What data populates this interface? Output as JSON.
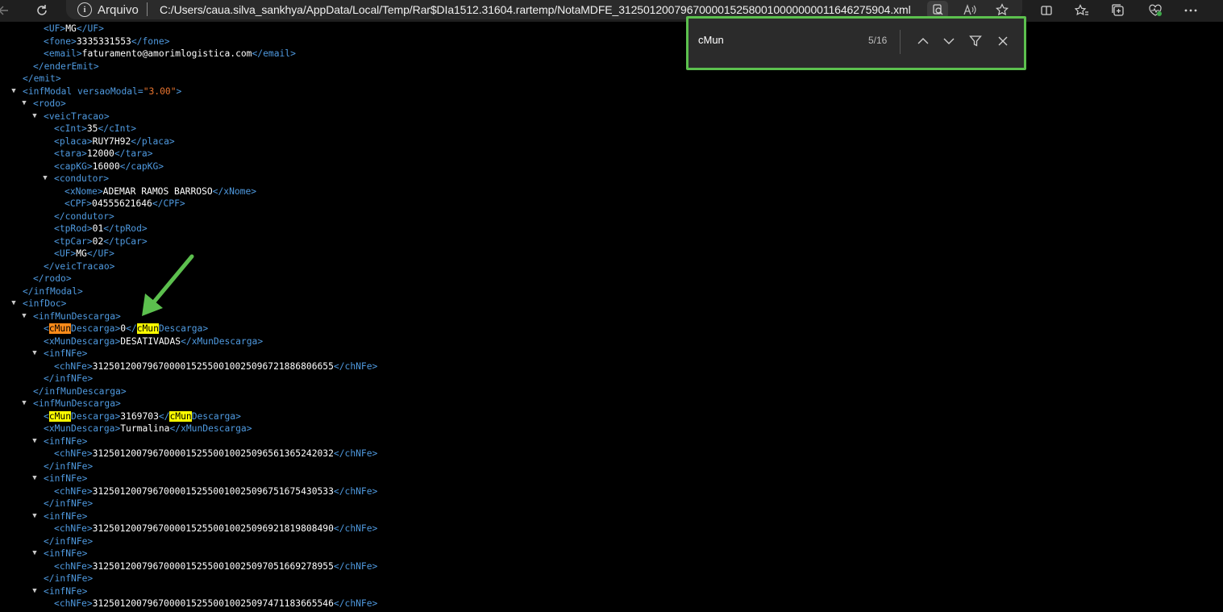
{
  "browser": {
    "site_label": "Arquivo",
    "url": "C:/Users/caua.silva_sankhya/AppData/Local/Temp/Rar$DIa1512.31604.rartemp/NotaMDFE_31250120079670000152580010000000011646275904.xml",
    "icons": [
      "back-icon",
      "refresh-icon",
      "info-icon",
      "extension-icon",
      "read-aloud-icon",
      "favorite-icon",
      "split-screen-icon",
      "favorites-icon",
      "collections-icon",
      "browser-essentials-icon",
      "more-icon"
    ]
  },
  "find": {
    "query": "cMun",
    "count": "5/16",
    "icons": [
      "chevron-up-icon",
      "chevron-down-icon",
      "filter-icon",
      "close-icon"
    ]
  },
  "colors": {
    "tag": "#4f9ae0",
    "attr_value": "#e8742f",
    "text": "#ffffff",
    "highlight": "#ffff00",
    "current_highlight": "#ff8c1a",
    "annotation": "#5cc04e"
  },
  "xml_lines": [
    {
      "d": 3,
      "open": "UF",
      "text": "MG",
      "close": "UF"
    },
    {
      "d": 3,
      "open": "fone",
      "text": "3335331553",
      "close": "fone"
    },
    {
      "d": 3,
      "open": "email",
      "text": "faturamento@amorimlogistica.com",
      "close": "email"
    },
    {
      "d": 2,
      "end": "enderEmit"
    },
    {
      "d": 1,
      "end": "emit"
    },
    {
      "d": 1,
      "open": "infModal",
      "attr": "versaoModal",
      "attrval": "\"3.00\"",
      "t": true
    },
    {
      "d": 2,
      "open": "rodo",
      "t": true
    },
    {
      "d": 3,
      "open": "veicTracao",
      "t": true
    },
    {
      "d": 4,
      "open": "cInt",
      "text": "35",
      "close": "cInt"
    },
    {
      "d": 4,
      "open": "placa",
      "text": "RUY7H92",
      "close": "placa"
    },
    {
      "d": 4,
      "open": "tara",
      "text": "12000",
      "close": "tara"
    },
    {
      "d": 4,
      "open": "capKG",
      "text": "16000",
      "close": "capKG"
    },
    {
      "d": 4,
      "open": "condutor",
      "t": true
    },
    {
      "d": 5,
      "open": "xNome",
      "text": "ADEMAR RAMOS BARROSO",
      "close": "xNome"
    },
    {
      "d": 5,
      "open": "CPF",
      "text": "04555621646",
      "close": "CPF"
    },
    {
      "d": 4,
      "end": "condutor"
    },
    {
      "d": 4,
      "open": "tpRod",
      "text": "01",
      "close": "tpRod"
    },
    {
      "d": 4,
      "open": "tpCar",
      "text": "02",
      "close": "tpCar"
    },
    {
      "d": 4,
      "open": "UF",
      "text": "MG",
      "close": "UF"
    },
    {
      "d": 3,
      "end": "veicTracao"
    },
    {
      "d": 2,
      "end": "rodo"
    },
    {
      "d": 1,
      "end": "infModal"
    },
    {
      "d": 1,
      "open": "infDoc",
      "t": true
    },
    {
      "d": 2,
      "open": "infMunDescarga",
      "t": true
    },
    {
      "d": 3,
      "open": "cMunDescarga",
      "text": "0",
      "close": "cMunDescarga",
      "hl": "cur"
    },
    {
      "d": 3,
      "open": "xMunDescarga",
      "text": "DESATIVADAS",
      "close": "xMunDescarga"
    },
    {
      "d": 3,
      "open": "infNFe",
      "t": true
    },
    {
      "d": 4,
      "open": "chNFe",
      "text": "31250120079670000152550010025096721886806655",
      "close": "chNFe"
    },
    {
      "d": 3,
      "end": "infNFe"
    },
    {
      "d": 2,
      "end": "infMunDescarga"
    },
    {
      "d": 2,
      "open": "infMunDescarga",
      "t": true
    },
    {
      "d": 3,
      "open": "cMunDescarga",
      "text": "3169703",
      "close": "cMunDescarga",
      "hl": "all"
    },
    {
      "d": 3,
      "open": "xMunDescarga",
      "text": "Turmalina",
      "close": "xMunDescarga"
    },
    {
      "d": 3,
      "open": "infNFe",
      "t": true
    },
    {
      "d": 4,
      "open": "chNFe",
      "text": "31250120079670000152550010025096561365242032",
      "close": "chNFe"
    },
    {
      "d": 3,
      "end": "infNFe"
    },
    {
      "d": 3,
      "open": "infNFe",
      "t": true
    },
    {
      "d": 4,
      "open": "chNFe",
      "text": "31250120079670000152550010025096751675430533",
      "close": "chNFe"
    },
    {
      "d": 3,
      "end": "infNFe"
    },
    {
      "d": 3,
      "open": "infNFe",
      "t": true
    },
    {
      "d": 4,
      "open": "chNFe",
      "text": "31250120079670000152550010025096921819808490",
      "close": "chNFe"
    },
    {
      "d": 3,
      "end": "infNFe"
    },
    {
      "d": 3,
      "open": "infNFe",
      "t": true
    },
    {
      "d": 4,
      "open": "chNFe",
      "text": "31250120079670000152550010025097051669278955",
      "close": "chNFe"
    },
    {
      "d": 3,
      "end": "infNFe"
    },
    {
      "d": 3,
      "open": "infNFe",
      "t": true
    },
    {
      "d": 4,
      "open": "chNFe",
      "text": "31250120079670000152550010025097471183665546",
      "close": "chNFe"
    }
  ]
}
